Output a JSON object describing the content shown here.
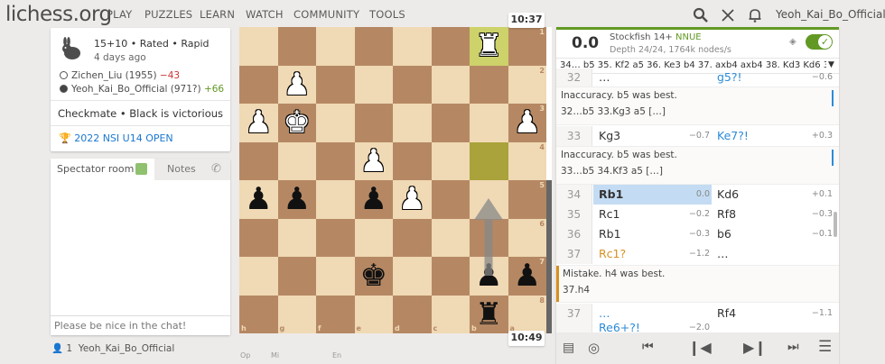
{
  "header": {
    "logo": "lichess.org",
    "nav": [
      "PLAY",
      "PUZZLES",
      "LEARN",
      "WATCH",
      "COMMUNITY",
      "TOOLS"
    ],
    "username": "Yeoh_Kai_Bo_Official"
  },
  "game_info": {
    "time_control": "15+10 • Rated • Rapid",
    "date": "4 days ago",
    "white_player": "Zichen_Liu (1955)",
    "white_diff": "−43",
    "black_player": "Yeoh_Kai_Bo_Official (971?)",
    "black_diff": "+66",
    "result": "Checkmate • Black is victorious",
    "tournament": "2022 NSI U14 OPEN"
  },
  "chat": {
    "tab_spectator": "Spectator room",
    "tab_notes": "Notes",
    "placeholder": "Please be nice in the chat!",
    "watchers_count": "1",
    "watcher": "Yeoh_Kai_Bo_Official"
  },
  "clocks": {
    "top": "10:37",
    "bottom": "10:49"
  },
  "board": {
    "files_label": [
      "h",
      "g",
      "f",
      "e",
      "d",
      "c",
      "b",
      "a"
    ],
    "ranks_label": [
      "1",
      "2",
      "3",
      "4",
      "5",
      "6",
      "7",
      "8"
    ],
    "rows": [
      [
        "",
        "",
        "",
        "",
        "",
        "",
        "wR",
        ""
      ],
      [
        "",
        "wP",
        "",
        "",
        "",
        "",
        "",
        ""
      ],
      [
        "wP",
        "wK",
        "",
        "",
        "",
        "",
        "",
        "wP"
      ],
      [
        "",
        "",
        "",
        "wP",
        "",
        "",
        "",
        ""
      ],
      [
        "bP",
        "bP",
        "",
        "bP",
        "wP",
        "",
        "",
        ""
      ],
      [
        "",
        "",
        "",
        "",
        "",
        "",
        "",
        ""
      ],
      [
        "",
        "",
        "",
        "bK",
        "",
        "",
        "bP",
        "bP"
      ],
      [
        "",
        "",
        "",
        "",
        "",
        "",
        "bR",
        ""
      ]
    ]
  },
  "engine": {
    "eval": "0.0",
    "name": "Stockfish 14+",
    "nnue": "NNUE",
    "depth": "Depth 24/24, 1764k nodes/s",
    "pv": "34… b5 35. Kf2 a5 36. Ke3 b4 37. axb4 axb4 38. Kd3 Kd6 39.…"
  },
  "moves": {
    "r32": {
      "num": "32",
      "w": "…",
      "b": "g5?!",
      "bev": "−0.6"
    },
    "c32": {
      "text": "Inaccuracy. b5 was best.",
      "line": "32…b5 33.Kg3 a5 […]"
    },
    "r33": {
      "num": "33",
      "w": "Kg3",
      "wev": "−0.7",
      "b": "Ke7?!",
      "bev": "+0.3"
    },
    "c33": {
      "text": "Inaccuracy. b5 was best.",
      "line": "33…b5 34.Kf3 a5 […]"
    },
    "r34": {
      "num": "34",
      "w": "Rb1",
      "wev": "0.0",
      "b": "Kd6",
      "bev": "+0.1"
    },
    "r35": {
      "num": "35",
      "w": "Rc1",
      "wev": "−0.2",
      "b": "Rf8",
      "bev": "−0.3"
    },
    "r36": {
      "num": "36",
      "w": "Rb1",
      "wev": "−0.3",
      "b": "b6",
      "bev": "−0.1"
    },
    "r37a": {
      "num": "37",
      "w": "Rc1?",
      "wev": "−1.2",
      "b": "…"
    },
    "c37": {
      "text": "Mistake. h4 was best.",
      "line": "37.h4"
    },
    "r37b": {
      "num": "37",
      "w": "…",
      "b": "Rf4",
      "bev": "−1.1"
    },
    "r38": {
      "w": "Re6+?!",
      "wev": "−2.0"
    }
  },
  "bottom_tabs": [
    "Op",
    "Mi",
    "En"
  ]
}
